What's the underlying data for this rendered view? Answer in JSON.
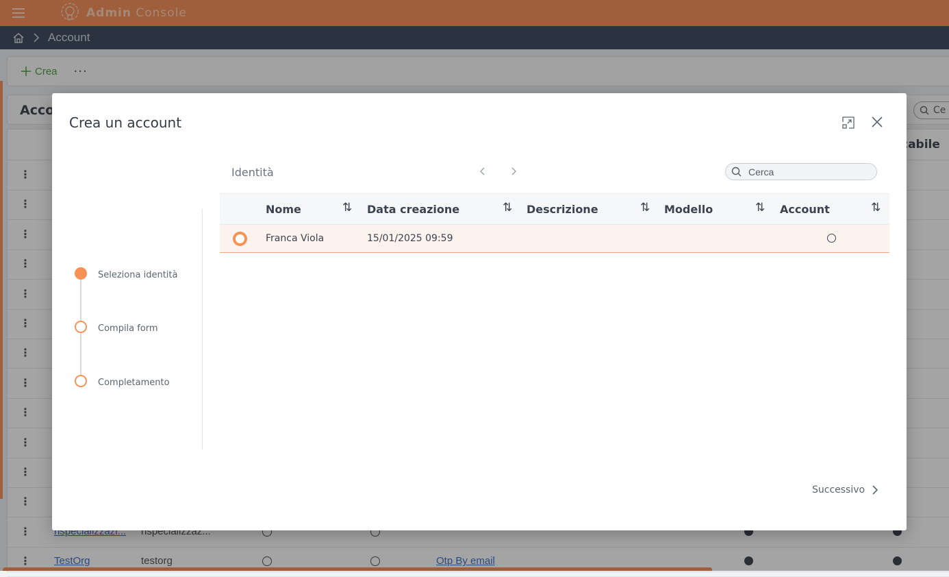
{
  "app": {
    "brand_bold": "Admin",
    "brand_light": "Console",
    "colors": {
      "brand": "#f07a3c",
      "nav": "#1e2c44",
      "accent": "#f79257",
      "selected_row": "#fdf3ee"
    }
  },
  "breadcrumb": {
    "home_icon": "home-icon",
    "separator_icon": "chevron-right-icon",
    "current": "Account"
  },
  "toolbar": {
    "create_label": "Crea",
    "more_label": "···"
  },
  "background_grid": {
    "title": "Acco",
    "search_placeholder": "Ce",
    "last_header": "cabile",
    "rows": [
      {
        "c1": "",
        "c2": ""
      },
      {
        "c1": "",
        "c2": ""
      },
      {
        "c1": "",
        "c2": ""
      },
      {
        "c1": "",
        "c2": ""
      },
      {
        "c1": "",
        "c2": ""
      },
      {
        "c1": "",
        "c2": ""
      },
      {
        "c1": "",
        "c2": ""
      },
      {
        "c1": "",
        "c2": ""
      },
      {
        "c1": "",
        "c2": ""
      },
      {
        "c1": "",
        "c2": ""
      },
      {
        "c1": "",
        "c2": ""
      },
      {
        "c1": "",
        "c2": ""
      },
      {
        "c1": "rispecializzazi...",
        "c2": "rispecializzaz...",
        "c5": ""
      },
      {
        "c1": "TestOrg",
        "c2": "testorg",
        "c5": "Otp By email"
      }
    ]
  },
  "dialog": {
    "title": "Crea un account",
    "steps": [
      {
        "label": "Seleziona identità",
        "state": "active"
      },
      {
        "label": "Compila form",
        "state": "pending"
      },
      {
        "label": "Completamento",
        "state": "pending"
      }
    ],
    "panel_title": "Identità",
    "search_placeholder": "Cerca",
    "table": {
      "columns": [
        "Nome",
        "Data creazione",
        "Descrizione",
        "Modello",
        "Account"
      ],
      "rows": [
        {
          "nome": "Franca Viola",
          "data_creazione": "15/01/2025 09:59",
          "descrizione": "",
          "modello": "",
          "account": false,
          "selected": true
        }
      ]
    },
    "next_label": "Successivo"
  }
}
